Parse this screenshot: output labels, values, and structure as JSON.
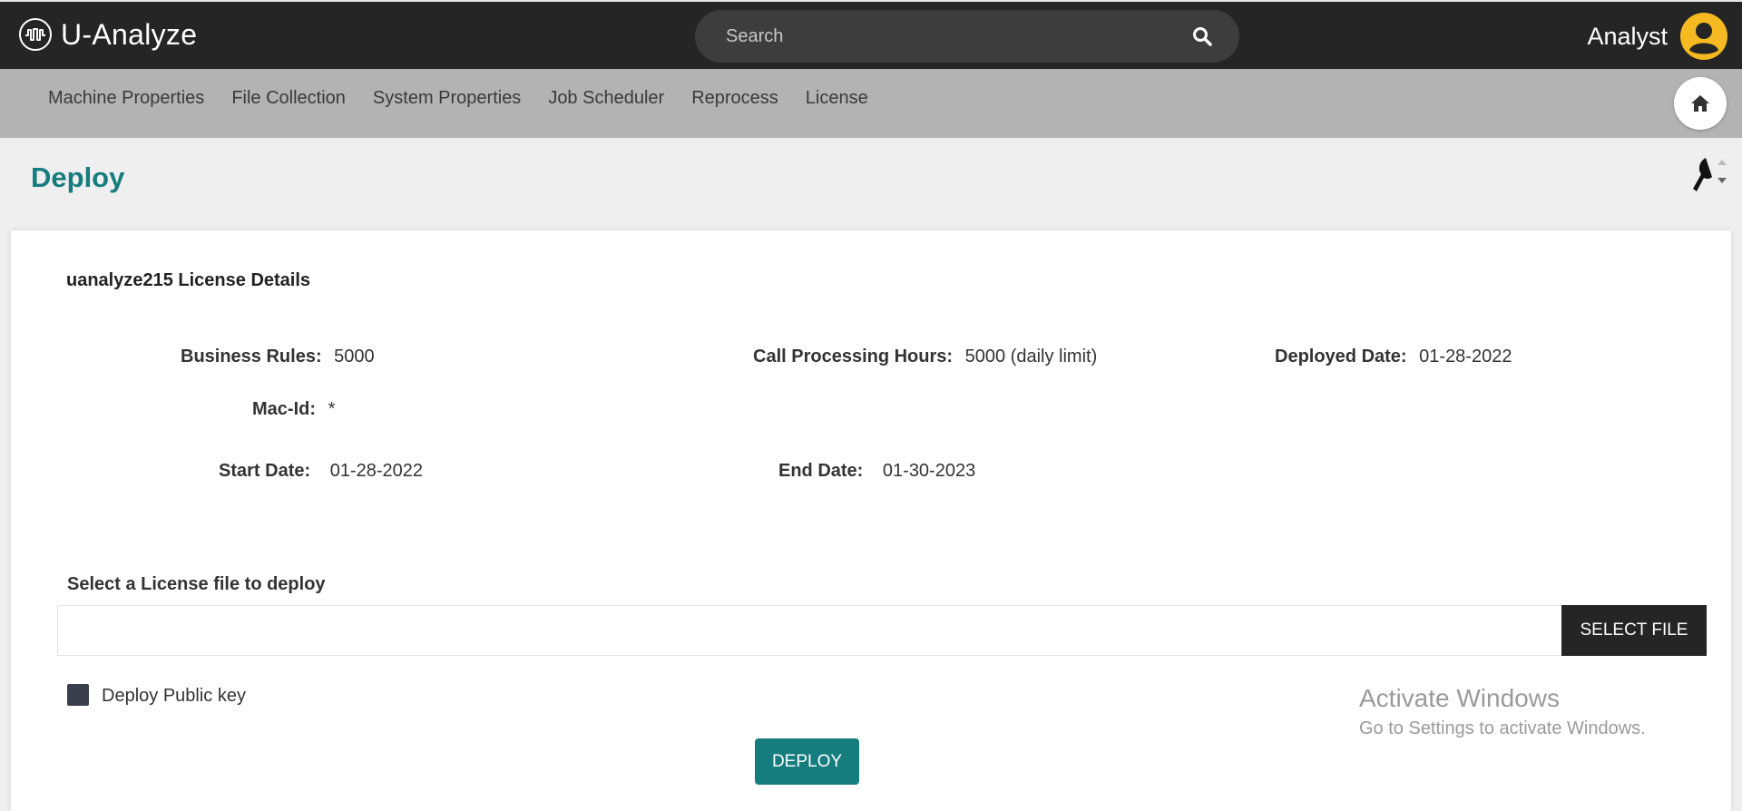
{
  "header": {
    "app_name": "U-Analyze",
    "search_placeholder": "Search",
    "user_name": "Analyst"
  },
  "nav": {
    "items": [
      "Machine Properties",
      "File Collection",
      "System Properties",
      "Job Scheduler",
      "Reprocess",
      "License"
    ]
  },
  "page": {
    "title": "Deploy"
  },
  "license": {
    "title": "uanalyze215 License Details",
    "business_rules_label": "Business Rules:",
    "business_rules_value": "5000",
    "call_hours_label": "Call Processing Hours:",
    "call_hours_value": "5000 (daily limit)",
    "deployed_date_label": "Deployed Date:",
    "deployed_date_value": "01-28-2022",
    "mac_id_label": "Mac-Id:",
    "mac_id_value": "*",
    "start_date_label": "Start Date:",
    "start_date_value": "01-28-2022",
    "end_date_label": "End Date:",
    "end_date_value": "01-30-2023"
  },
  "upload": {
    "label": "Select a License file to deploy",
    "select_button": "SELECT FILE",
    "checkbox_label": "Deploy Public key",
    "deploy_button": "DEPLOY"
  },
  "watermark": {
    "line1": "Activate Windows",
    "line2": "Go to Settings to activate Windows."
  },
  "colors": {
    "accent": "#167d7f",
    "topbar": "#252525",
    "navbar": "#b3b3b3",
    "avatar": "#f5b921"
  }
}
